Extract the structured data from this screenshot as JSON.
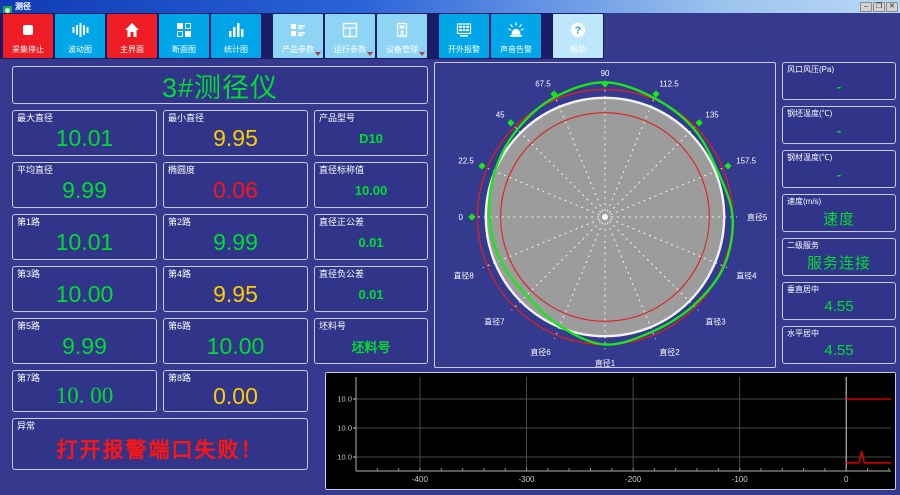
{
  "window": {
    "title": "测径",
    "controls": [
      {
        "name": "minimize",
        "glyph": "–"
      },
      {
        "name": "maximize",
        "glyph": "❒"
      },
      {
        "name": "close",
        "glyph": "✕"
      }
    ]
  },
  "toolbar": {
    "buttons": [
      {
        "label": "采集停止",
        "icon": "stop-icon",
        "style": "red",
        "group": 0,
        "dropdown": false
      },
      {
        "label": "波动图",
        "icon": "waveform-icon",
        "style": "cyan",
        "group": 0,
        "dropdown": false
      },
      {
        "label": "主界面",
        "icon": "home-icon",
        "style": "red",
        "group": 0,
        "dropdown": false
      },
      {
        "label": "断面图",
        "icon": "section-grid-icon",
        "style": "cyan",
        "group": 0,
        "dropdown": false
      },
      {
        "label": "统计图",
        "icon": "barchart-icon",
        "style": "cyan",
        "group": 0,
        "dropdown": false
      },
      {
        "label": "产品参数",
        "icon": "product-params-icon",
        "style": "light",
        "group": 1,
        "dropdown": true
      },
      {
        "label": "运行参数",
        "icon": "run-params-icon",
        "style": "light",
        "group": 1,
        "dropdown": true
      },
      {
        "label": "设备管理",
        "icon": "device-manage-icon",
        "style": "light",
        "group": 1,
        "dropdown": true
      },
      {
        "label": "开外报警",
        "icon": "external-screen-icon",
        "style": "cyan",
        "group": 2,
        "dropdown": false
      },
      {
        "label": "声音告警",
        "icon": "siren-icon",
        "style": "cyan",
        "group": 2,
        "dropdown": false
      },
      {
        "label": "帮助",
        "icon": "help-icon",
        "style": "lighter",
        "group": 3,
        "dropdown": false
      }
    ]
  },
  "left_panel": {
    "title": "3#测径仪",
    "rows": [
      [
        {
          "label": "最大直径",
          "value": "10.01",
          "color": "green"
        },
        {
          "label": "最小直径",
          "value": "9.95",
          "color": "yellow"
        },
        {
          "label": "产品型号",
          "value": "D10",
          "color": "green",
          "small": true
        }
      ],
      [
        {
          "label": "平均直径",
          "value": "9.99",
          "color": "green"
        },
        {
          "label": "椭圆度",
          "value": "0.06",
          "color": "red"
        },
        {
          "label": "直径标称值",
          "value": "10.00",
          "color": "green",
          "small": true
        }
      ],
      [
        {
          "label": "第1路",
          "value": "10.01",
          "color": "green"
        },
        {
          "label": "第2路",
          "value": "9.99",
          "color": "green"
        },
        {
          "label": "直径正公差",
          "value": "0.01",
          "color": "green",
          "small": true
        }
      ],
      [
        {
          "label": "第3路",
          "value": "10.00",
          "color": "green"
        },
        {
          "label": "第4路",
          "value": "9.95",
          "color": "yellow"
        },
        {
          "label": "直径负公差",
          "value": "0.01",
          "color": "green",
          "small": true
        }
      ],
      [
        {
          "label": "第5路",
          "value": "9.99",
          "color": "green"
        },
        {
          "label": "第6路",
          "value": "10.00",
          "color": "green"
        },
        {
          "label": "坯料号",
          "value": "坯料号",
          "color": "green",
          "small": true
        }
      ],
      [
        {
          "label": "第7路",
          "value": "10. 00",
          "color": "green",
          "serif": true
        },
        {
          "label": "第8路",
          "value": "0.00",
          "color": "yellow"
        }
      ]
    ],
    "alarm": {
      "label": "异常",
      "value": "打开报警端口失败！"
    }
  },
  "right_panel": {
    "boxes": [
      {
        "label": "风口风压(Pa)",
        "value": "-",
        "color": "green",
        "big": false
      },
      {
        "label": "钢坯温度(℃)",
        "value": "-",
        "color": "green",
        "big": false
      },
      {
        "label": "钢材温度(℃)",
        "value": "-",
        "color": "green",
        "big": false
      },
      {
        "label": "速度(m/s)",
        "value": "速度",
        "color": "green",
        "big": true
      },
      {
        "label": "二级服务",
        "value": "服务连接",
        "color": "green",
        "big": true
      },
      {
        "label": "垂直居中",
        "value": "4.55",
        "color": "green",
        "big": true
      },
      {
        "label": "水平居中",
        "value": "4.55",
        "color": "green",
        "big": true
      }
    ]
  },
  "colors": {
    "value_green": "#00dd30",
    "value_yellow": "#ffcc00",
    "value_red": "#ff1414",
    "profile_green": "#1ae61a",
    "tolerance_red": "#dd2020",
    "nominal_gray": "#9c9c9c",
    "toolbar_red": "#ee1c25",
    "toolbar_cyan": "#00a6e8",
    "toolbar_light": "#8ed4f4",
    "background_indigo": "#353a8e"
  },
  "chart_data": [
    {
      "type": "polar-profile",
      "title": "断面轮廓图 (cross-section profile, 8 diameter channels)",
      "nominal_radius": 1.0,
      "tolerance_outer_r": 1.07,
      "tolerance_inner_r": 0.875,
      "profile_angles_deg": [
        0,
        22.5,
        45,
        67.5,
        90,
        112.5,
        135,
        157.5,
        180,
        202.5,
        225,
        247.5,
        270,
        292.5,
        315,
        337.5
      ],
      "profile_r": [
        1.07,
        1.02,
        1.05,
        1.08,
        1.13,
        1.09,
        1.04,
        1.0,
        0.97,
        0.95,
        0.93,
        0.99,
        1.07,
        1.04,
        1.05,
        1.08
      ],
      "spoke_labels": [
        {
          "deg": 180,
          "text": "0",
          "marker": true
        },
        {
          "deg": 157.5,
          "text": "22.5",
          "marker": true
        },
        {
          "deg": 135,
          "text": "45",
          "marker": true
        },
        {
          "deg": 112.5,
          "text": "67.5",
          "marker": true
        },
        {
          "deg": 90,
          "text": "90",
          "marker": true
        },
        {
          "deg": 67.5,
          "text": "112.5",
          "marker": true
        },
        {
          "deg": 45,
          "text": "135",
          "marker": true
        },
        {
          "deg": 22.5,
          "text": "157.5",
          "marker": true
        },
        {
          "deg": 0,
          "text": "直径5",
          "marker": false
        },
        {
          "deg": 337.5,
          "text": "直径4",
          "marker": false
        },
        {
          "deg": 315,
          "text": "直径3",
          "marker": false
        },
        {
          "deg": 292.5,
          "text": "直径2",
          "marker": false
        },
        {
          "deg": 270,
          "text": "直径1",
          "marker": false
        },
        {
          "deg": 247.5,
          "text": "直径6",
          "marker": false
        },
        {
          "deg": 225,
          "text": "直径7",
          "marker": false
        },
        {
          "deg": 202.5,
          "text": "直径8",
          "marker": false
        }
      ]
    },
    {
      "type": "line",
      "title": "直径趋势 (diameter trend)",
      "xlim": [
        -460,
        42
      ],
      "xticks": [
        -400,
        -300,
        -200,
        -100,
        0
      ],
      "minor_tick_step": 20,
      "ytick_labels": [
        "10.0",
        "10.0",
        "10.0"
      ],
      "grid": true,
      "plot_bg": "#000000",
      "zero_line_x": 0,
      "series": [
        {
          "name": "upper-trace",
          "color": "#d40000",
          "points_gy": [
            [
              0,
              1.0
            ],
            [
              42,
              1.0
            ]
          ]
        },
        {
          "name": "lower-trace",
          "color": "#d40000",
          "points_gy": [
            [
              0,
              3.2
            ],
            [
              12,
              3.2
            ],
            [
              14.5,
              2.8
            ],
            [
              17,
              3.2
            ],
            [
              42,
              3.2
            ]
          ]
        }
      ]
    }
  ]
}
